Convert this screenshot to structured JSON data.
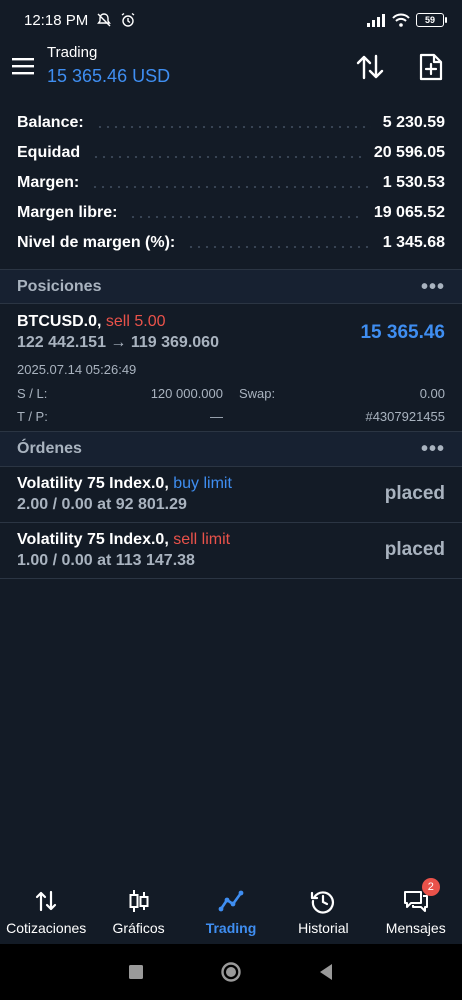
{
  "status": {
    "time": "12:18 PM",
    "battery": "59"
  },
  "header": {
    "title": "Trading",
    "balance": "15 365.46 USD"
  },
  "summary": [
    {
      "label": "Balance:",
      "value": "5 230.59"
    },
    {
      "label": "Equidad",
      "value": "20 596.05"
    },
    {
      "label": "Margen:",
      "value": "1 530.53"
    },
    {
      "label": "Margen libre:",
      "value": "19 065.52"
    },
    {
      "label": "Nivel de margen (%):",
      "value": "1 345.68"
    }
  ],
  "positions": {
    "title": "Posiciones",
    "more": "•••",
    "item": {
      "symbol": "BTCUSD.0,",
      "side": "sell 5.00",
      "prices": "122 442.151 → 119 369.060",
      "profit": "15 365.46",
      "datetime": "2025.07.14 05:26:49",
      "sl_label": "S / L:",
      "sl_value": "120 000.000",
      "swap_label": "Swap:",
      "swap_value": "0.00",
      "tp_label": "T / P:",
      "tp_value": "—",
      "ticket": "#4307921455"
    }
  },
  "orders": {
    "title": "Órdenes",
    "more": "•••",
    "items": [
      {
        "symbol": "Volatility 75 Index.0,",
        "type": "buy limit",
        "detail": "2.00 / 0.00 at 92 801.29",
        "state": "placed"
      },
      {
        "symbol": "Volatility 75 Index.0,",
        "type": "sell limit",
        "detail": "1.00 / 0.00 at 113 147.38",
        "state": "placed"
      }
    ]
  },
  "nav": [
    {
      "label": "Cotizaciones",
      "icon": "quotes-icon"
    },
    {
      "label": "Gráficos",
      "icon": "charts-icon"
    },
    {
      "label": "Trading",
      "icon": "trading-icon"
    },
    {
      "label": "Historial",
      "icon": "history-icon"
    },
    {
      "label": "Mensajes",
      "icon": "messages-icon",
      "badge": "2"
    }
  ],
  "colors": {
    "accent": "#3f8ef1",
    "sell": "#e9524a",
    "background": "#131b26"
  }
}
